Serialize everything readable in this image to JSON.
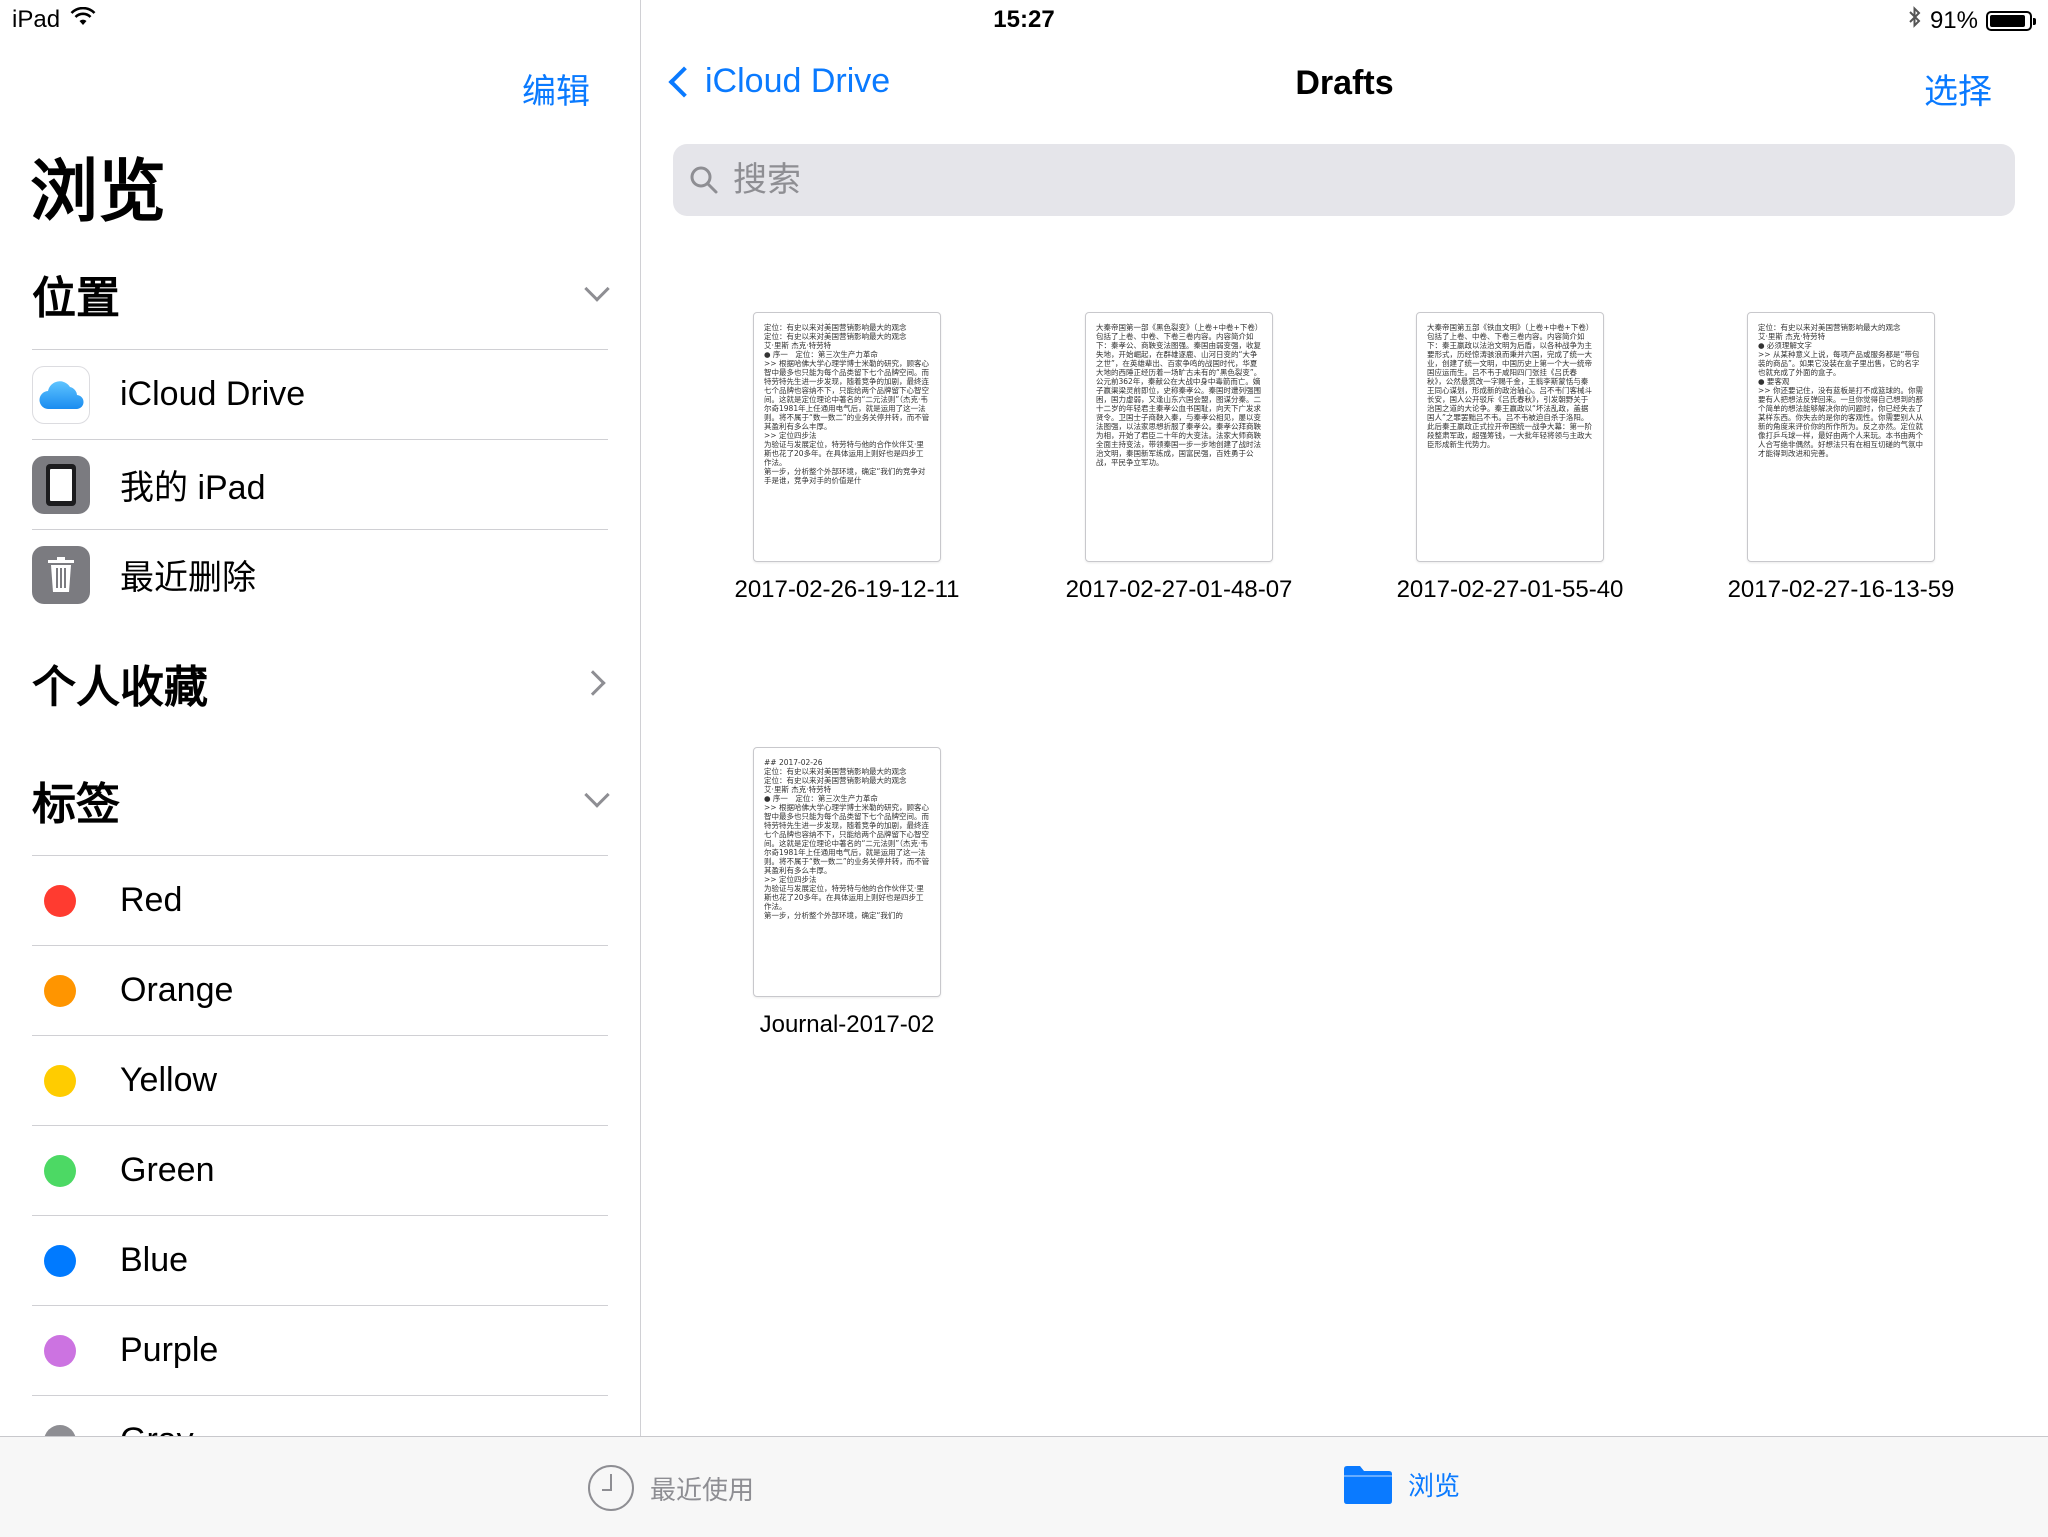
{
  "status_bar": {
    "device": "iPad",
    "time": "15:27",
    "battery": "91%",
    "battery_level": 0.91
  },
  "sidebar": {
    "edit_label": "编辑",
    "title": "浏览",
    "locations": {
      "header": "位置",
      "items": [
        {
          "label": "iCloud Drive",
          "icon": "icloud-icon"
        },
        {
          "label": "我的 iPad",
          "icon": "ipad-icon"
        },
        {
          "label": "最近删除",
          "icon": "trash-icon"
        }
      ]
    },
    "favorites": {
      "header": "个人收藏"
    },
    "tags": {
      "header": "标签",
      "items": [
        {
          "label": "Red",
          "color": "#ff3b30"
        },
        {
          "label": "Orange",
          "color": "#ff9500"
        },
        {
          "label": "Yellow",
          "color": "#ffcc00"
        },
        {
          "label": "Green",
          "color": "#4cd964"
        },
        {
          "label": "Blue",
          "color": "#007aff"
        },
        {
          "label": "Purple",
          "color": "#cc73e1"
        },
        {
          "label": "Gray",
          "color": "#8e8e93"
        }
      ]
    }
  },
  "main": {
    "back_label": "iCloud Drive",
    "title": "Drafts",
    "select_label": "选择",
    "search": {
      "placeholder": "搜索"
    },
    "files": [
      {
        "name": "2017-02-26-19-12-11",
        "preview": [
          "定位：有史以来对美国营销影响最大的观念",
          "定位：有史以来对美国营销影响最大的观念",
          "艾·里斯 杰克·特劳特",
          "",
          "● 序一　定位：第三次生产力革命",
          "",
          ">> 根据哈佛大学心理学博士米勒的研究，顾客心智中最多也只能为每个品类留下七个品牌空间。而特劳特先生进一步发现，随着竞争的加剧，最终连七个品牌也容纳不下，只能给两个品牌留下心智空间。这就是定位理论中著名的“二元法则”（杰克·韦尔奇1981年上任通用电气后，就是运用了这一法则。将不属于“数一数二”的业务关停并转，而不管其盈利有多么丰厚。",
          "",
          ">> 定位四步法",
          "为验证与发展定位，特劳特与他的合作伙伴艾·里斯也花了20多年。在具体运用上则好也是四步工作法。",
          "第一步，分析整个外部环境，确定“我们的竞争对手是谁，竞争对手的价值是什"
        ]
      },
      {
        "name": "2017-02-27-01-48-07",
        "preview": [
          "大秦帝国第一部《黑色裂变》（上卷+中卷+下卷）包括了上卷、中卷、下卷三卷内容。内容简介如下：秦孝公、商鞅变法图强。秦国由弱变强，收复失地，开始崛起，在群雄逐鹿、山河日变的“大争之世”，在英雄辈出、百家争鸣的战国时代，华夏大地的西陲正经历着一场旷古未有的“黑色裂变”。公元前362年，秦献公在大战中身中毒箭而亡。嫡子嬴渠梁灵前即位，史称秦孝公。秦国时遭列强围困，国力虚弱，又逢山东六国会盟，图谋分秦。二十二岁的年轻君主秦孝公血书国耻，向天下广发求贤令。卫国士子商鞅入秦，与秦孝公相见，屡以变法图强，以法家思想折服了秦孝公。秦孝公拜商鞅为相，开始了君臣二十年的大变法。法家大师商鞅全面主持变法，带领秦国一步一步地创建了战时法治文明，秦国新军练成，国富民强，百姓勇于公战，平民争立军功。"
        ]
      },
      {
        "name": "2017-02-27-01-55-40",
        "preview": [
          "大秦帝国第五部《铁血文明》（上卷+中卷+下卷）包括了上卷、中卷、下卷三卷内容。内容简介如下：秦王嬴政以法治文明为后盾，以各种战争为主要形式，历经惊涛骇浪而秉并六国，完成了统一大业，创建了统一文明，中国历史上第一个大一统帝国应运而生。吕不韦于咸阳四门张挂《吕氏春秋》，公然悬赏改一字赐千金，王翦李斯蒙恬与秦王同心谋划，形成新的政治轴心。吕不韦门客械斗长安，国人公开驳斥《吕氏春秋》，引发朝野关于治国之道的大论争。秦王嬴政以“坏法乱政，盖据国人”之罪罢黜吕不韦。吕不韦被迫自杀于洛阳。此后秦王嬴政正式拉开帝国统一战争大幕：第一阶段整肃军政，超强筹钱，一大批年轻将领与主政大臣形成新生代势力。"
        ]
      },
      {
        "name": "2017-02-27-16-13-59",
        "preview": [
          "定位：有史以来对美国营销影响最大的观念",
          "艾·里斯 杰克·特劳特",
          "",
          "● 必须理解文字",
          "",
          ">> 从某种意义上说，每项产品或服务都是“带包装的商品”。如果它没装在盒子里出售，它的名字也就充成了外面的盒子。",
          "",
          "● 要客观",
          "",
          ">> 你还要记住，没有蓝板是打不成篮球的。你需要有人把想法反弹回来。一旦你觉得自己想到的那个简单的想法能够解决你的问题时，你已经失去了某样东西。你失去的是你的客观性。你需要别人从新的角度来评价你的所作所为。反之亦然。定位就像打乒乓球一样，最好由两个人来玩。本书由两个人合写绝非偶然。好想法只有在相互切磋的气氛中才能得到改进和完善。"
        ]
      },
      {
        "name": "Journal-2017-02",
        "preview": [
          "## 2017-02-26",
          "定位：有史以来对美国营销影响最大的观念",
          "定位：有史以来对美国营销影响最大的观念",
          "艾·里斯 杰克·特劳特",
          "",
          "● 序一　定位：第三次生产力革命",
          "",
          ">> 根据哈佛大学心理学博士米勒的研究，顾客心智中最多也只能为每个品类留下七个品牌空间。而特劳特先生进一步发现，随着竞争的加剧，最终连七个品牌也容纳不下，只能给两个品牌留下心智空间。这就是定位理论中著名的“二元法则”（杰克·韦尔奇1981年上任通用电气后，就是运用了这一法则。将不属于“数一数二”的业务关停并转，而不管其盈利有多么丰厚。",
          "",
          ">> 定位四步法",
          "为验证与发展定位，特劳特与他的合作伙伴艾·里斯也花了20多年。在具体运用上则好也是四步工作法。",
          "第一步，分析整个外部环境，确定“我们的"
        ]
      }
    ]
  },
  "tab_bar": {
    "items": [
      {
        "label": "最近使用",
        "icon": "clock-icon",
        "selected": false
      },
      {
        "label": "浏览",
        "icon": "folder-icon",
        "selected": true
      }
    ]
  }
}
